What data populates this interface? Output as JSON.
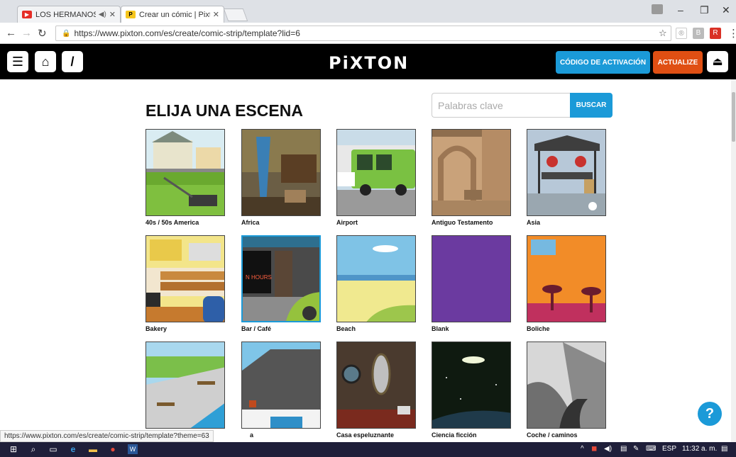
{
  "browser": {
    "tabs": [
      {
        "title": "LOS HERMANOS CUR",
        "favicon": "youtube-icon",
        "color": "#e52d27"
      },
      {
        "title": "Crear un cómic | Pixton p",
        "favicon": "pixton-icon",
        "color": "#f6c61d",
        "active": true
      }
    ],
    "url": "https://www.pixton.com/es/create/comic-strip/template?lid=6",
    "status_url": "https://www.pixton.com/es/create/comic-strip/template?theme=63"
  },
  "header": {
    "logo": "PiXTON",
    "activate_label": "CÓDIGO DE ACTIVACIÓN",
    "upgrade_label": "ACTUALIZE"
  },
  "page": {
    "title": "ELIJA UNA ESCENA",
    "search_placeholder": "Palabras clave",
    "search_button": "BUSCAR",
    "help": "?",
    "partial_caption": "a"
  },
  "scenes": [
    {
      "label": "40s / 50s America",
      "art": "suburb"
    },
    {
      "label": "Africa",
      "art": "africa"
    },
    {
      "label": "Airport",
      "art": "airport"
    },
    {
      "label": "Antiguo Testamento",
      "art": "ancient"
    },
    {
      "label": "Asia",
      "art": "asia"
    },
    {
      "label": "Bakery",
      "art": "bakery"
    },
    {
      "label": "Bar / Café",
      "art": "bar",
      "selected": true
    },
    {
      "label": "Beach",
      "art": "beach"
    },
    {
      "label": "Blank",
      "art": "blank"
    },
    {
      "label": "Boliche",
      "art": "boliche"
    },
    {
      "label": "",
      "art": "park"
    },
    {
      "label": "",
      "art": "house"
    },
    {
      "label": "Casa espeluznante",
      "art": "spooky"
    },
    {
      "label": "Ciencia ficción",
      "art": "scifi"
    },
    {
      "label": "Coche / caminos",
      "art": "road"
    }
  ],
  "taskbar": {
    "lang": "ESP",
    "time": "11:32 a. m."
  }
}
